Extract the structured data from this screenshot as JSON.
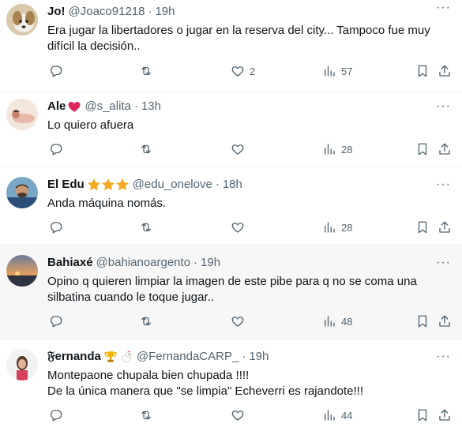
{
  "tweets": [
    {
      "name": "Jo!",
      "handle": "@Joaco91218",
      "time": "19h",
      "lines": [
        "Era jugar la libertadores o jugar en la reserva del city... Tampoco fue muy",
        "difícil la decisión.."
      ],
      "likes": "2",
      "views": "57"
    },
    {
      "name": "Ale",
      "handle": "@s_alita",
      "time": "13h",
      "lines": [
        "Lo quiero afuera"
      ],
      "likes": "",
      "views": "28"
    },
    {
      "name": "El Edu",
      "handle": "@edu_onelove",
      "time": "18h",
      "lines": [
        "Anda máquina nomás."
      ],
      "likes": "",
      "views": "28"
    },
    {
      "name": "Bahiaxé",
      "handle": "@bahianoargento",
      "time": "19h",
      "lines": [
        "Opino q quieren limpiar la imagen de este pibe para q no se coma una",
        "silbatina cuando le toque jugar.."
      ],
      "likes": "",
      "views": "48"
    },
    {
      "name": "𝔉ernanda",
      "handle": "@FernandaCARP_",
      "time": "19h",
      "lines": [
        "Montepaone chupala bien chupada !!!!",
        "De la única manera que \"se limpia\" Echeverri es rajandote!!!"
      ],
      "likes": "",
      "views": "44"
    }
  ],
  "separator": "·",
  "more_label": "···",
  "colors": {
    "text": "#0f1419",
    "muted": "#536471",
    "divider": "#eff3f4",
    "highlight_bg": "#f7f7f7",
    "heart": "#e0245e",
    "star": "#f4a81d"
  },
  "icons": [
    "reply-icon",
    "retweet-icon",
    "like-icon",
    "views-icon",
    "bookmark-icon",
    "share-icon",
    "more-icon"
  ]
}
